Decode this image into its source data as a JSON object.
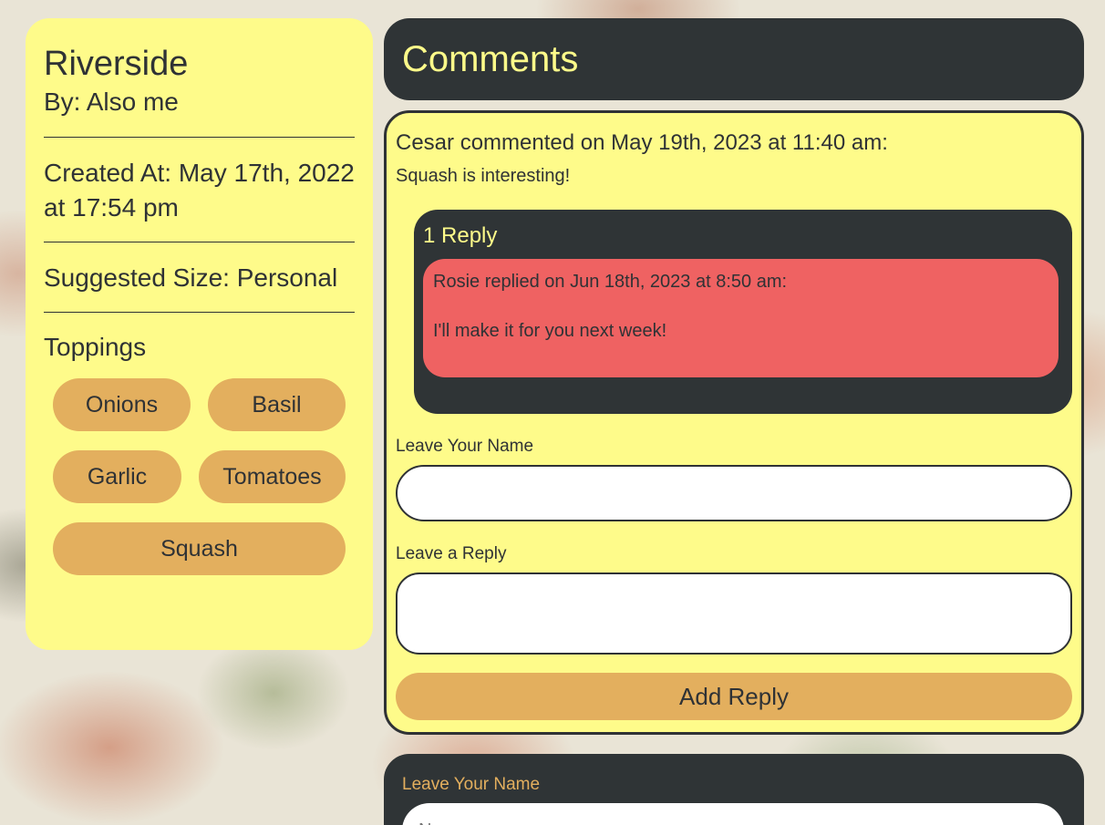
{
  "pizza": {
    "name": "Riverside",
    "author": "By: Also me",
    "created": "Created At: May 17th, 2022 at 17:54 pm",
    "size": "Suggested Size: Personal",
    "toppings_title": "Toppings",
    "toppings": [
      "Onions",
      "Basil",
      "Garlic",
      "Tomatoes",
      "Squash"
    ]
  },
  "comments": {
    "title": "Comments",
    "comment": {
      "header": "Cesar commented on May 19th, 2023 at 11:40 am:",
      "body": "Squash is interesting!",
      "replies_count": "1 Reply",
      "reply": {
        "header": "Rosie replied on Jun 18th, 2023 at 8:50 am:",
        "body": "I'll make it for you next week!"
      },
      "form": {
        "name_label": "Leave Your Name",
        "name_value": "",
        "reply_label": "Leave a Reply",
        "reply_value": "",
        "submit_label": "Add Reply"
      }
    },
    "new_comment": {
      "name_label": "Leave Your Name",
      "name_placeholder": "Name"
    }
  },
  "colors": {
    "card_yellow": "#fefb8a",
    "dark": "#2f3436",
    "pill_orange": "#e3af5e",
    "reply_red": "#ef6262"
  }
}
